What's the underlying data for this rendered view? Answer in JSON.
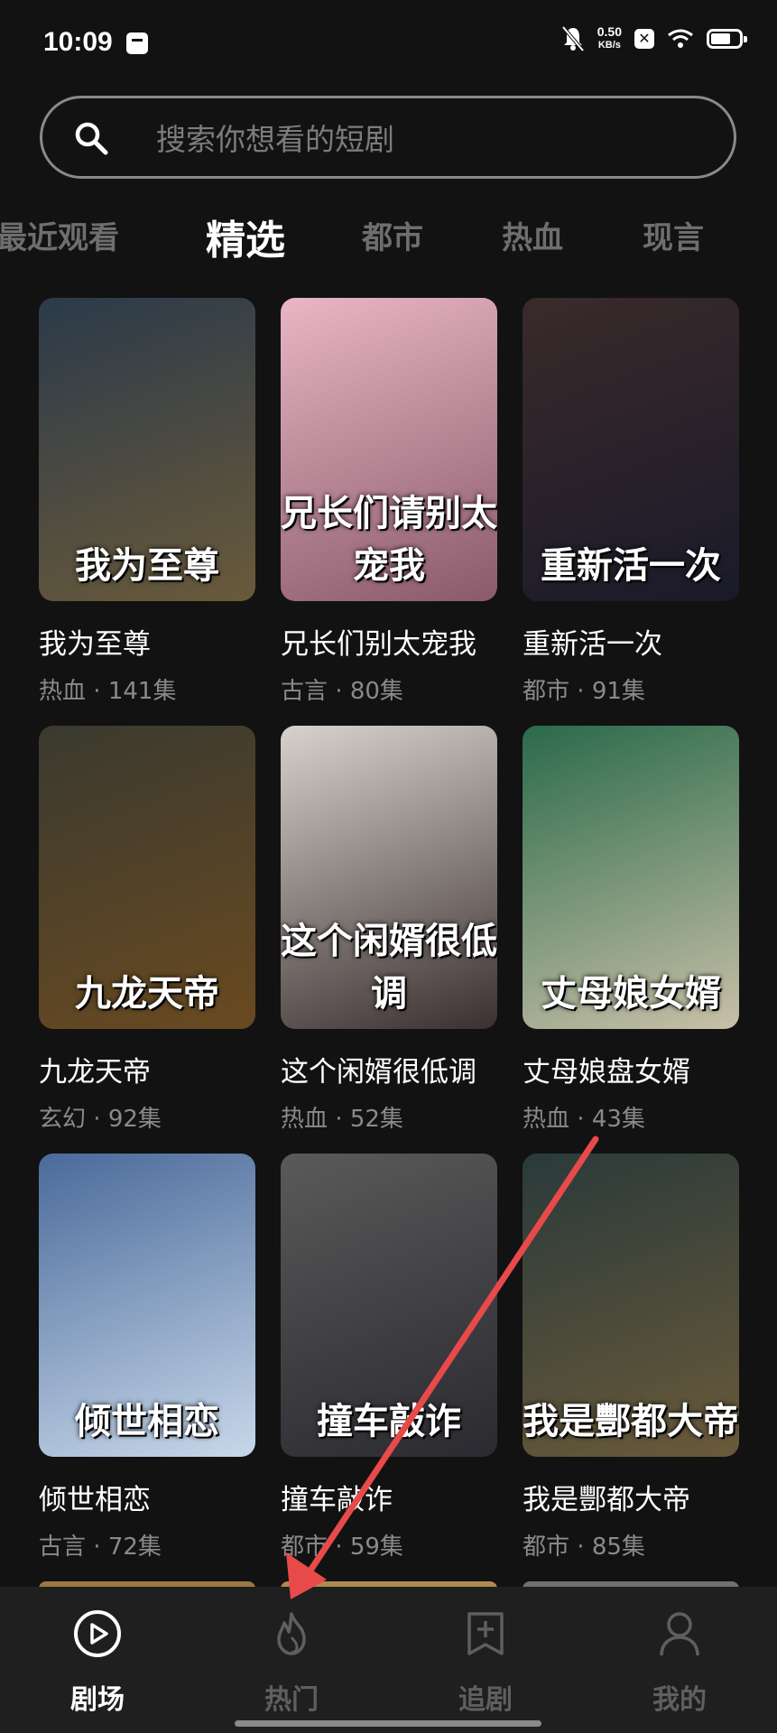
{
  "status_bar": {
    "time": "10:09",
    "speed_value": "0.50",
    "speed_unit": "KB/s"
  },
  "search": {
    "placeholder": "搜索你想看的短剧"
  },
  "tabs": [
    {
      "label": "最近观看",
      "active": false
    },
    {
      "label": "精选",
      "active": true
    },
    {
      "label": "都市",
      "active": false
    },
    {
      "label": "热血",
      "active": false
    },
    {
      "label": "现言",
      "active": false
    }
  ],
  "dramas": [
    {
      "title": "我为至尊",
      "genre": "热血",
      "episodes": "141集",
      "poster_text": "我为至尊",
      "colors": [
        "#2b3a4a",
        "#6a5a3a"
      ]
    },
    {
      "title": "兄长们别太宠我",
      "genre": "古言",
      "episodes": "80集",
      "poster_text": "兄长们请别太宠我",
      "colors": [
        "#e8b6c4",
        "#8a5a6a"
      ]
    },
    {
      "title": "重新活一次",
      "genre": "都市",
      "episodes": "91集",
      "poster_text": "重新活一次",
      "colors": [
        "#3a2a2a",
        "#1a1a2a"
      ]
    },
    {
      "title": "九龙天帝",
      "genre": "玄幻",
      "episodes": "92集",
      "poster_text": "九龙天帝",
      "colors": [
        "#3a3a30",
        "#6a4a20"
      ]
    },
    {
      "title": "这个闲婿很低调",
      "genre": "热血",
      "episodes": "52集",
      "poster_text": "这个闲婿很低调",
      "colors": [
        "#d8d2cc",
        "#3a3030"
      ]
    },
    {
      "title": "丈母娘盘女婿",
      "genre": "热血",
      "episodes": "43集",
      "poster_text": "丈母娘女婿",
      "colors": [
        "#2a6a4a",
        "#c8c0a8"
      ]
    },
    {
      "title": "倾世相恋",
      "genre": "古言",
      "episodes": "72集",
      "poster_text": "倾世相恋",
      "colors": [
        "#4a6a9a",
        "#c8d8ea"
      ]
    },
    {
      "title": "撞车敲诈",
      "genre": "都市",
      "episodes": "59集",
      "poster_text": "撞车敲诈",
      "colors": [
        "#5a5a5a",
        "#2a2a30"
      ]
    },
    {
      "title": "我是酆都大帝",
      "genre": "都市",
      "episodes": "85集",
      "poster_text": "我是酆都大帝",
      "colors": [
        "#2a3a3a",
        "#6a5a3a"
      ]
    }
  ],
  "meta_separator": " · ",
  "bottom_nav": [
    {
      "label": "剧场",
      "icon": "play-circle-icon",
      "active": true
    },
    {
      "label": "热门",
      "icon": "flame-icon",
      "active": false
    },
    {
      "label": "追剧",
      "icon": "bookmark-add-icon",
      "active": false
    },
    {
      "label": "我的",
      "icon": "user-icon",
      "active": false
    }
  ],
  "annotation": {
    "color": "#e84a4a"
  }
}
